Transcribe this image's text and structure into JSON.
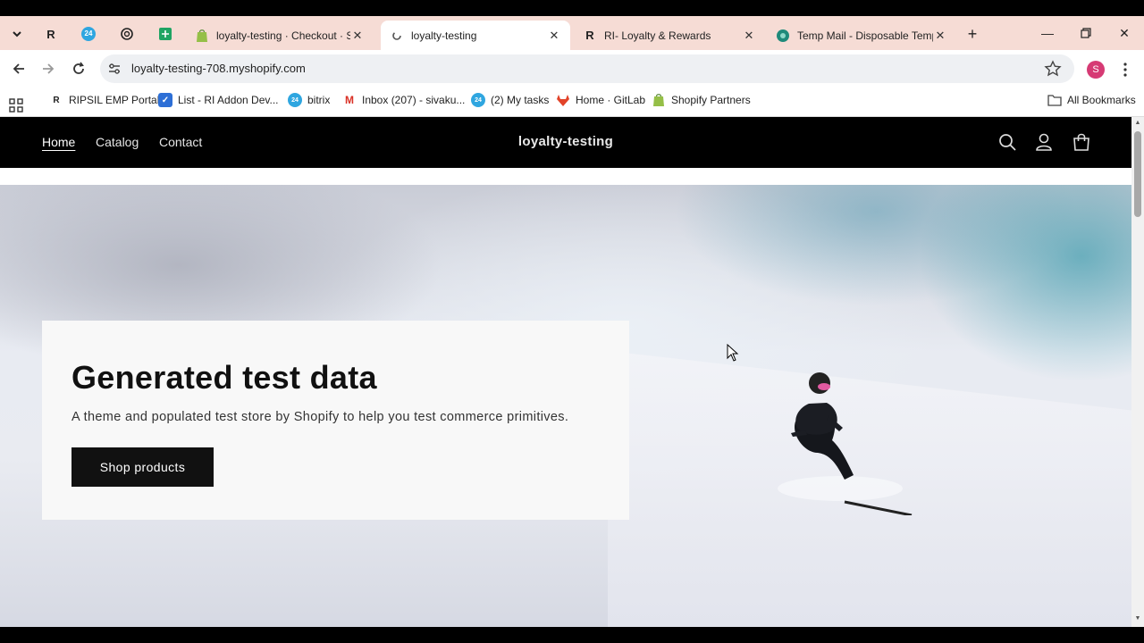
{
  "browser": {
    "tabs": [
      {
        "title": "loyalty-testing · Checkout · Sh",
        "active": false
      },
      {
        "title": "loyalty-testing",
        "active": true
      },
      {
        "title": "RI- Loyalty & Rewards",
        "active": false
      },
      {
        "title": "Temp Mail - Disposable Tempo",
        "active": false
      }
    ],
    "pinned_letter": "R",
    "pinned_badge": "24",
    "url": "loyalty-testing-708.myshopify.com",
    "profile_initial": "S",
    "profile_color": "#d63a74",
    "bookmarks": [
      {
        "label": "RIPSIL EMP Portal",
        "icon_text": "R"
      },
      {
        "label": "List - RI Addon Dev...",
        "icon_text": ""
      },
      {
        "label": "bitrix",
        "icon_text": "24"
      },
      {
        "label": "Inbox (207) - sivaku...",
        "icon_text": "M"
      },
      {
        "label": "(2) My tasks",
        "icon_text": "24"
      },
      {
        "label": "Home · GitLab",
        "icon_text": ""
      },
      {
        "label": "Shopify Partners",
        "icon_text": ""
      }
    ],
    "all_bookmarks_label": "All Bookmarks"
  },
  "store": {
    "brand": "loyalty-testing",
    "nav": [
      {
        "label": "Home"
      },
      {
        "label": "Catalog"
      },
      {
        "label": "Contact"
      }
    ],
    "hero": {
      "heading": "Generated test data",
      "subheading": "A theme and populated test store by Shopify to help you test commerce primitives.",
      "button_label": "Shop products"
    }
  },
  "colors": {
    "tab_strip": "#f6dcd5",
    "store_header": "#000000",
    "button": "#111111",
    "card": "#f8f8f8"
  }
}
